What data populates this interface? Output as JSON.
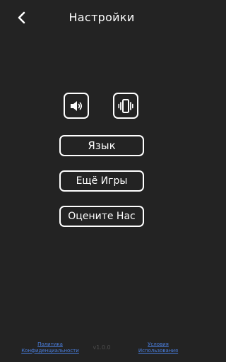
{
  "header": {
    "title": "Настройки",
    "back_icon": "chevron-left-icon"
  },
  "controls": {
    "sound_icon": "speaker-icon",
    "vibration_icon": "vibration-icon"
  },
  "menu": {
    "language_label": "Язык",
    "more_games_label": "Ещё Игры",
    "rate_us_label": "Оцените Нас"
  },
  "footer": {
    "privacy_line1": "Политика",
    "privacy_line2": "Конфиденциальности",
    "version": "v1.0.0",
    "terms_line1": "Условия",
    "terms_line2": "Использования",
    "link_color": "#4a7fe0"
  },
  "colors": {
    "background": "#232323",
    "foreground": "#ffffff"
  }
}
